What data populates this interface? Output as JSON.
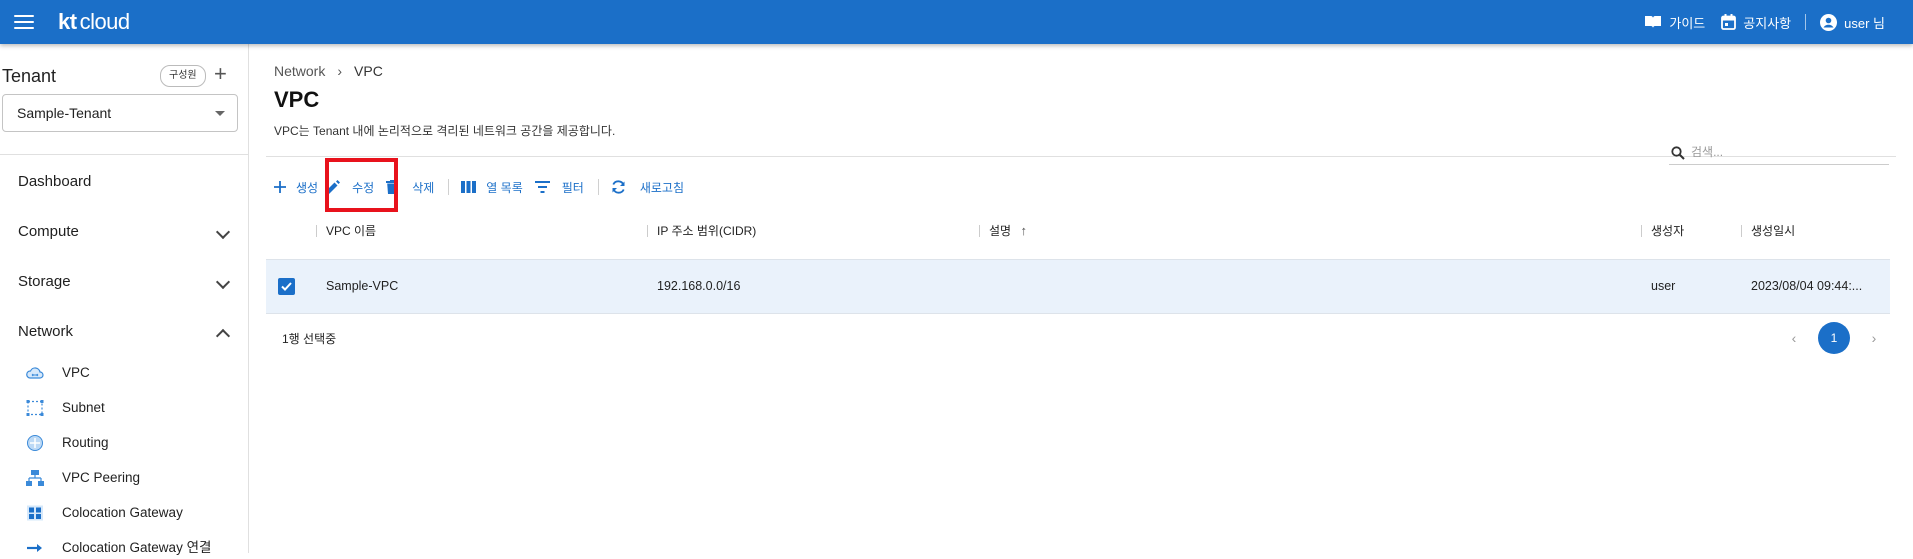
{
  "topbar": {
    "logo_kt": "kt",
    "logo_cloud": "cloud",
    "guide_label": "가이드",
    "notice_label": "공지사항",
    "user_label": "user 님",
    "bg_color": "#1b6fc8"
  },
  "sidebar": {
    "tenant_title": "Tenant",
    "member_button": "구성원",
    "add_button": "+",
    "tenant_selected": "Sample-Tenant",
    "nav": [
      {
        "label": "Dashboard",
        "expandable": false
      },
      {
        "label": "Compute",
        "expandable": true,
        "expanded": false
      },
      {
        "label": "Storage",
        "expandable": true,
        "expanded": false
      },
      {
        "label": "Network",
        "expandable": true,
        "expanded": true
      }
    ],
    "network_items": [
      {
        "label": "VPC",
        "icon": "vpc-cloud-icon"
      },
      {
        "label": "Subnet",
        "icon": "subnet-icon"
      },
      {
        "label": "Routing",
        "icon": "routing-icon"
      },
      {
        "label": "VPC Peering",
        "icon": "vpc-peering-icon"
      },
      {
        "label": "Colocation Gateway",
        "icon": "colocation-gateway-icon"
      },
      {
        "label": "Colocation Gateway 연결",
        "icon": "arrow-right-icon"
      }
    ]
  },
  "main": {
    "breadcrumb": [
      "Network",
      "VPC"
    ],
    "title": "VPC",
    "description": "VPC는 Tenant 내에 논리적으로 격리된 네트워크 공간을 제공합니다.",
    "toolbar": {
      "create": "생성",
      "edit": "수정",
      "delete": "삭제",
      "columns": "열 목록",
      "filter": "필터",
      "refresh": "새로고침"
    },
    "search_placeholder": "검색...",
    "table": {
      "columns": [
        "VPC 이름",
        "IP 주소 범위(CIDR)",
        "설명",
        "생성자",
        "생성일시"
      ],
      "rows": [
        {
          "selected": true,
          "name": "Sample-VPC",
          "cidr": "192.168.0.0/16",
          "description": "",
          "creator": "user",
          "created_at": "2023/08/04 09:44:..."
        }
      ]
    },
    "selected_count": "1행 선택중",
    "pagination": {
      "current_page": "1"
    }
  },
  "colors": {
    "accent": "#1b6fc8",
    "highlight": "#e8121c",
    "row_selected": "#eaf2fb"
  }
}
